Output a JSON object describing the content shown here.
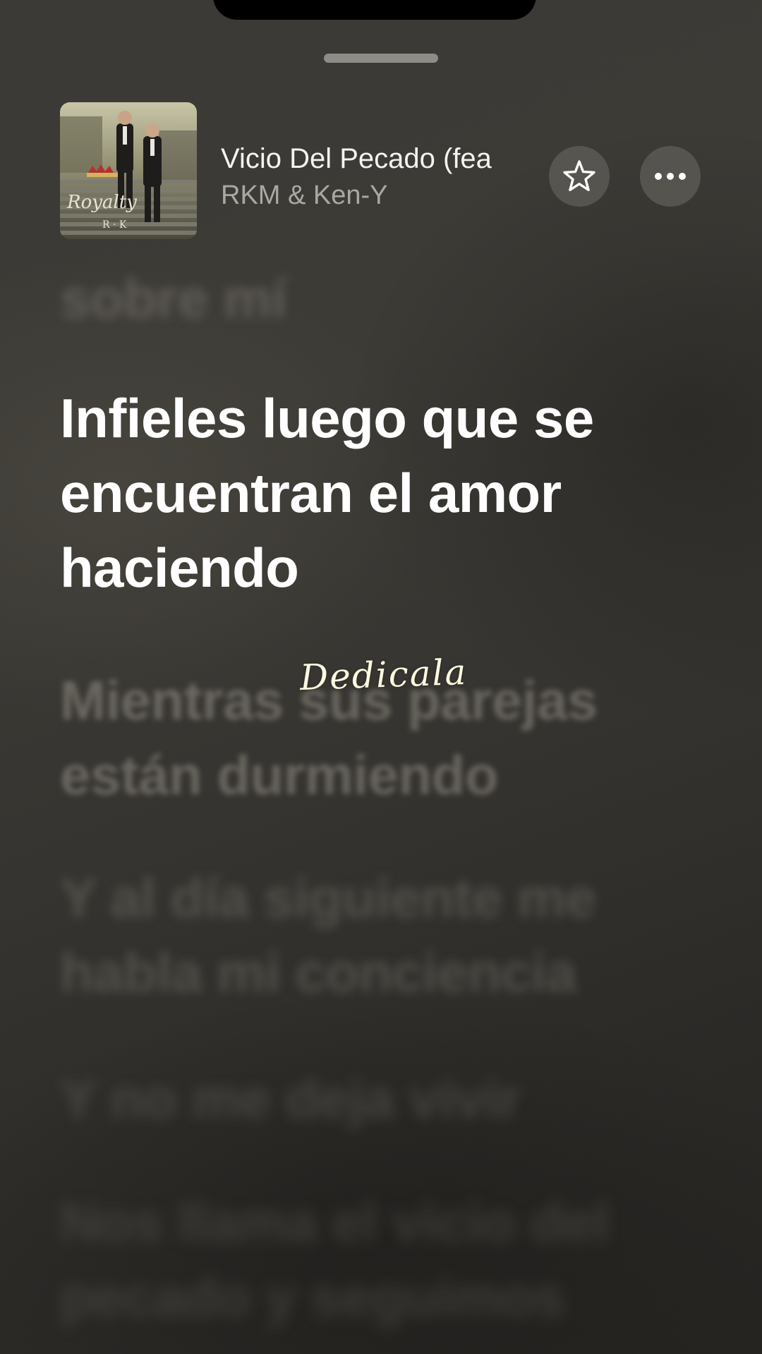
{
  "song": {
    "title": "Vicio Del Pecado (fea",
    "artist": "RKM & Ken-Y",
    "artwork_icon": "album-artwork-royalty"
  },
  "buttons": {
    "favorite_icon": "star-icon",
    "more_icon": "ellipsis-icon"
  },
  "lyrics": {
    "previous": "sobre mí",
    "current": "Infieles luego que se encuentran el amor haciendo",
    "upcoming": [
      "Mientras sus parejas están durmiendo",
      "Y al día siguiente me habla mi conciencia",
      "Y no me deja vivir",
      "Nos llama el vicio del pecado y seguimos"
    ]
  },
  "overlay": {
    "dedication": "Dedicala"
  },
  "colors": {
    "background": "#3a3834",
    "active_lyric": "#ffffff",
    "dedication": "#fffbe0"
  }
}
